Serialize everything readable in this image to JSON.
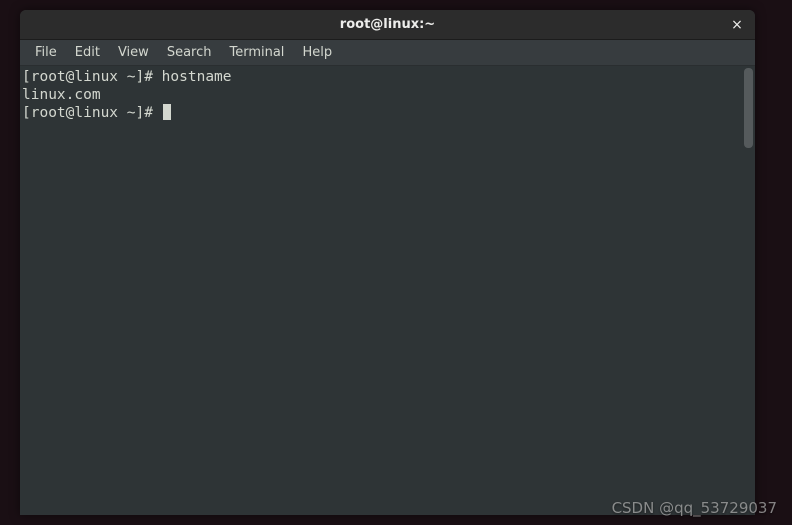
{
  "window": {
    "title": "root@linux:~",
    "close_label": "×"
  },
  "menubar": {
    "items": [
      {
        "label": "File"
      },
      {
        "label": "Edit"
      },
      {
        "label": "View"
      },
      {
        "label": "Search"
      },
      {
        "label": "Terminal"
      },
      {
        "label": "Help"
      }
    ]
  },
  "terminal": {
    "lines": [
      "[root@linux ~]# hostname",
      "linux.com",
      "[root@linux ~]# "
    ]
  },
  "watermark": "CSDN @qq_53729037"
}
